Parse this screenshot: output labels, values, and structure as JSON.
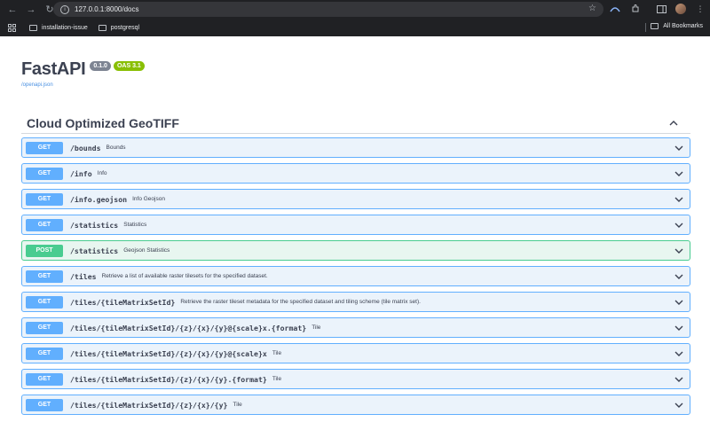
{
  "browser": {
    "url": "127.0.0.1:8000/docs",
    "bookmarks": [
      {
        "label": "installation-issue",
        "icon": "folder-icon"
      },
      {
        "label": "postgresql",
        "icon": "folder-icon"
      }
    ],
    "all_bookmarks_label": "All Bookmarks"
  },
  "header": {
    "title": "FastAPI",
    "version_badge": "0.1.0",
    "oas_badge": "OAS 3.1",
    "openapi_link": "/openapi.json"
  },
  "colors": {
    "get": "#61affe",
    "post": "#49cc90",
    "oas_badge": "#89bf04",
    "version_badge": "#7d8492"
  },
  "tag": {
    "title": "Cloud Optimized GeoTIFF"
  },
  "operations": [
    {
      "method": "GET",
      "path": "/bounds",
      "summary": "Bounds"
    },
    {
      "method": "GET",
      "path": "/info",
      "summary": "Info"
    },
    {
      "method": "GET",
      "path": "/info.geojson",
      "summary": "Info Geojson"
    },
    {
      "method": "GET",
      "path": "/statistics",
      "summary": "Statistics"
    },
    {
      "method": "POST",
      "path": "/statistics",
      "summary": "Geojson Statistics"
    },
    {
      "method": "GET",
      "path": "/tiles",
      "summary": "Retrieve a list of available raster tilesets for the specified dataset."
    },
    {
      "method": "GET",
      "path": "/tiles/{tileMatrixSetId}",
      "summary": "Retrieve the raster tileset metadata for the specified dataset and tiling scheme (tile matrix set)."
    },
    {
      "method": "GET",
      "path": "/tiles/{tileMatrixSetId}/{z}/{x}/{y}@{scale}x.{format}",
      "summary": "Tile"
    },
    {
      "method": "GET",
      "path": "/tiles/{tileMatrixSetId}/{z}/{x}/{y}@{scale}x",
      "summary": "Tile"
    },
    {
      "method": "GET",
      "path": "/tiles/{tileMatrixSetId}/{z}/{x}/{y}.{format}",
      "summary": "Tile"
    },
    {
      "method": "GET",
      "path": "/tiles/{tileMatrixSetId}/{z}/{x}/{y}",
      "summary": "Tile"
    }
  ]
}
